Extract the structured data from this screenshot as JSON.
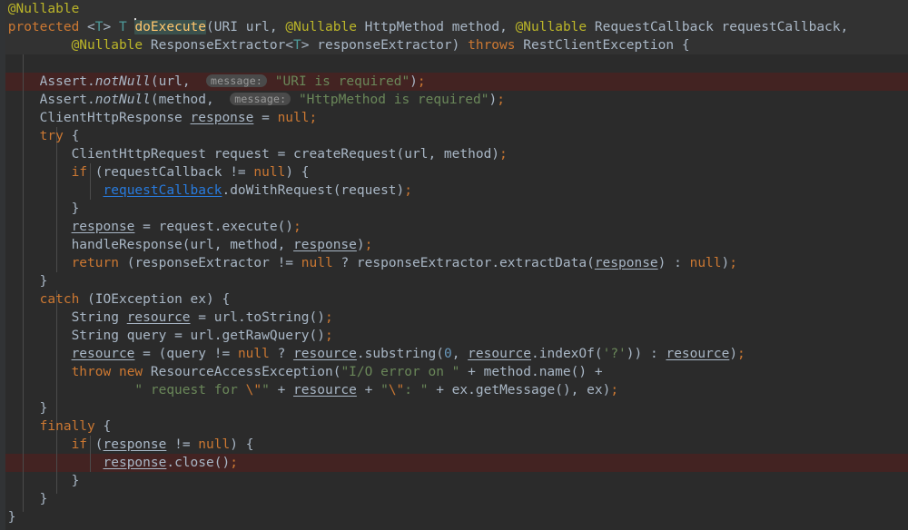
{
  "editor": {
    "theme_name": "darcula",
    "background": "#2b2b2b",
    "sticky_header_background": "#323232",
    "highlight_line_background": "#432322",
    "default_text_color": "#a9b7c6",
    "keyword_color": "#cc7832",
    "string_color": "#6a8759",
    "annotation_color": "#bbb529",
    "method_color": "#ffc66d",
    "link_color": "#287bde",
    "generic_param_color": "#4e9a9a",
    "inlay_hint_background": "#4a4a4a",
    "inlay_hint_color": "#9a9a9a",
    "identifier_highlight_background": "#3b514d",
    "caret_color": "#d8d8d8"
  },
  "inlay_hints": {
    "message_1": "message:",
    "message_2": "message:"
  },
  "code": {
    "language": "java",
    "method_name": "doExecute",
    "lines": [
      "@Nullable",
      "protected <T> T doExecute(URI url, @Nullable HttpMethod method, @Nullable RequestCallback requestCallback,",
      "        @Nullable ResponseExtractor<T> responseExtractor) throws RestClientException {",
      "",
      "    Assert.notNull(url, message: \"URI is required\");",
      "    Assert.notNull(method, message: \"HttpMethod is required\");",
      "    ClientHttpResponse response = null;",
      "    try {",
      "        ClientHttpRequest request = createRequest(url, method);",
      "        if (requestCallback != null) {",
      "            requestCallback.doWithRequest(request);",
      "        }",
      "        response = request.execute();",
      "        handleResponse(url, method, response);",
      "        return (responseExtractor != null ? responseExtractor.extractData(response) : null);",
      "    }",
      "    catch (IOException ex) {",
      "        String resource = url.toString();",
      "        String query = url.getRawQuery();",
      "        resource = (query != null ? resource.substring(0, resource.indexOf('?')) : resource);",
      "        throw new ResourceAccessException(\"I/O error on \" + method.name() +",
      "                \" request for \\\"\" + resource + \"\\\": \" + ex.getMessage(), ex);",
      "    }",
      "    finally {",
      "        if (response != null) {",
      "            response.close();",
      "        }",
      "    }",
      "}"
    ],
    "highlighted_line_numbers": [
      5,
      26
    ],
    "sticky_header_line_numbers": [
      1,
      2,
      3
    ]
  }
}
